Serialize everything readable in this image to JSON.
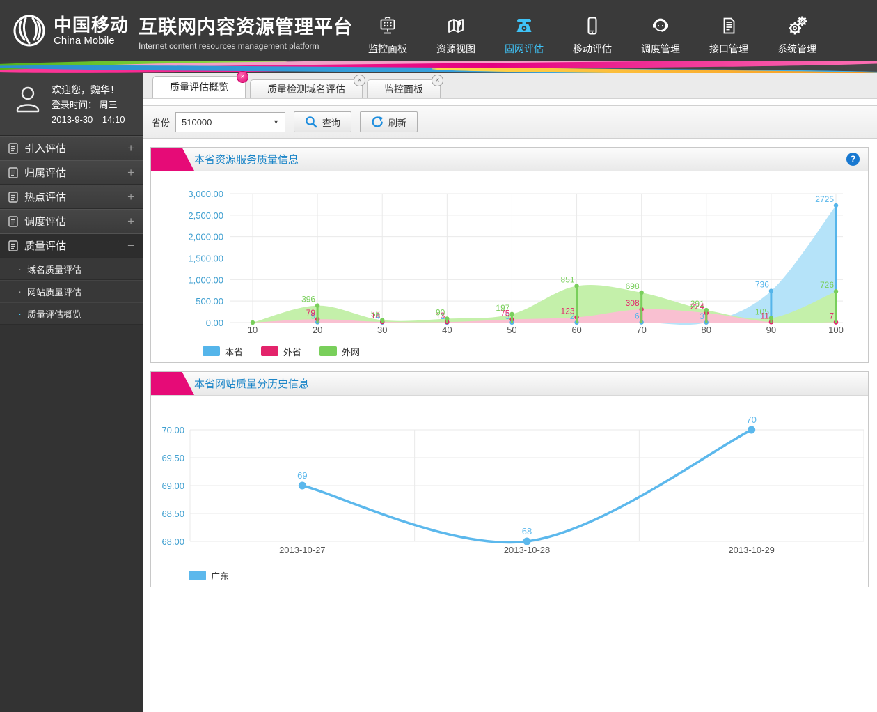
{
  "header": {
    "brand_cn": "中国移动",
    "brand_en": "China Mobile",
    "title_cn": "互联网内容资源管理平台",
    "title_en": "Internet content resources management platform",
    "nav": [
      {
        "label": "监控面板",
        "icon": "dashboard-icon",
        "active": false
      },
      {
        "label": "资源视图",
        "icon": "map-icon",
        "active": false
      },
      {
        "label": "固网评估",
        "icon": "phone-icon",
        "active": true
      },
      {
        "label": "移动评估",
        "icon": "mobile-icon",
        "active": false
      },
      {
        "label": "调度管理",
        "icon": "operator-icon",
        "active": false
      },
      {
        "label": "接口管理",
        "icon": "interface-icon",
        "active": false
      },
      {
        "label": "系统管理",
        "icon": "gears-icon",
        "active": false
      }
    ]
  },
  "sidebar": {
    "welcome": "欢迎您，魏华！",
    "login_label": "登录时间：",
    "login_day": "周三",
    "login_date": "2013-9-30",
    "login_time": "14:10",
    "menu": [
      {
        "label": "引入评估",
        "expanded": false,
        "active": false
      },
      {
        "label": "归属评估",
        "expanded": false,
        "active": false
      },
      {
        "label": "热点评估",
        "expanded": false,
        "active": false
      },
      {
        "label": "调度评估",
        "expanded": false,
        "active": false
      },
      {
        "label": "质量评估",
        "expanded": true,
        "active": true,
        "children": [
          {
            "label": "域名质量评估",
            "active": false
          },
          {
            "label": "网站质量评估",
            "active": false
          },
          {
            "label": "质量评估概览",
            "active": true
          }
        ]
      }
    ]
  },
  "tabs": [
    {
      "label": "质量评估概览",
      "active": true
    },
    {
      "label": "质量检测域名评估",
      "active": false
    },
    {
      "label": "监控面板",
      "active": false
    }
  ],
  "filter": {
    "province_label": "省份",
    "province_value": "510000",
    "query_label": "查询",
    "refresh_label": "刷新"
  },
  "icons": {
    "close": "×",
    "dropdown": "▼",
    "help": "?",
    "expand": "+",
    "collapse": "−",
    "bullet": "·"
  },
  "panels": [
    {
      "title": "本省资源服务质量信息",
      "has_help": true
    },
    {
      "title": "本省网站质量分历史信息",
      "has_help": false
    }
  ],
  "colors": {
    "header_bg": "#3a3a3a",
    "nav_active": "#3fc3f7",
    "magenta_flag": "#e60b77",
    "panel_title": "#1d86c8",
    "axis_label": "#3f9fd0",
    "tick_label": "#555555",
    "gridline": "#e9e9e9"
  },
  "chart_data": [
    {
      "type": "area",
      "title": "本省资源服务质量信息",
      "x": [
        10,
        20,
        30,
        40,
        50,
        60,
        70,
        80,
        90,
        100
      ],
      "xlabel": "",
      "ylabel": "",
      "ylim": [
        0,
        3000
      ],
      "ytick_values": [
        0,
        500,
        1000,
        1500,
        2000,
        2500,
        3000
      ],
      "ytick_labels": [
        "0.00",
        "500.00",
        "1,000.00",
        "1,500.00",
        "2,000.00",
        "2,500.00",
        "3,000.00"
      ],
      "grid": true,
      "legend_position": "bottom",
      "series": [
        {
          "name": "本省",
          "line_color": "#55b5ea",
          "fill_color": "#b5e3f9",
          "values": [
            0,
            9,
            4,
            1,
            3,
            2,
            6,
            3,
            736,
            2725
          ]
        },
        {
          "name": "外省",
          "line_color": "#e3236b",
          "fill_color": "#f9c0d1",
          "values": [
            0,
            79,
            16,
            13,
            75,
            123,
            308,
            224,
            11,
            7
          ]
        },
        {
          "name": "外网",
          "line_color": "#79cf5b",
          "fill_color": "#c4f0aa",
          "values": [
            0,
            396,
            56,
            90,
            197,
            851,
            698,
            291,
            105,
            726
          ]
        }
      ],
      "draw_order": [
        "本省",
        "外网",
        "外省"
      ]
    },
    {
      "type": "line",
      "title": "本省网站质量分历史信息",
      "categories": [
        "2013-10-27",
        "2013-10-28",
        "2013-10-29"
      ],
      "xlabel": "",
      "ylabel": "",
      "ylim": [
        68,
        70
      ],
      "ytick_values": [
        68,
        68.5,
        69,
        69.5,
        70
      ],
      "ytick_labels": [
        "68.00",
        "68.50",
        "69.00",
        "69.50",
        "70.00"
      ],
      "grid": true,
      "legend_position": "bottom",
      "series": [
        {
          "name": "广东",
          "line_color": "#5cb8ec",
          "fill_color": "#4fb3ea",
          "values": [
            69,
            68,
            70
          ]
        }
      ]
    }
  ]
}
